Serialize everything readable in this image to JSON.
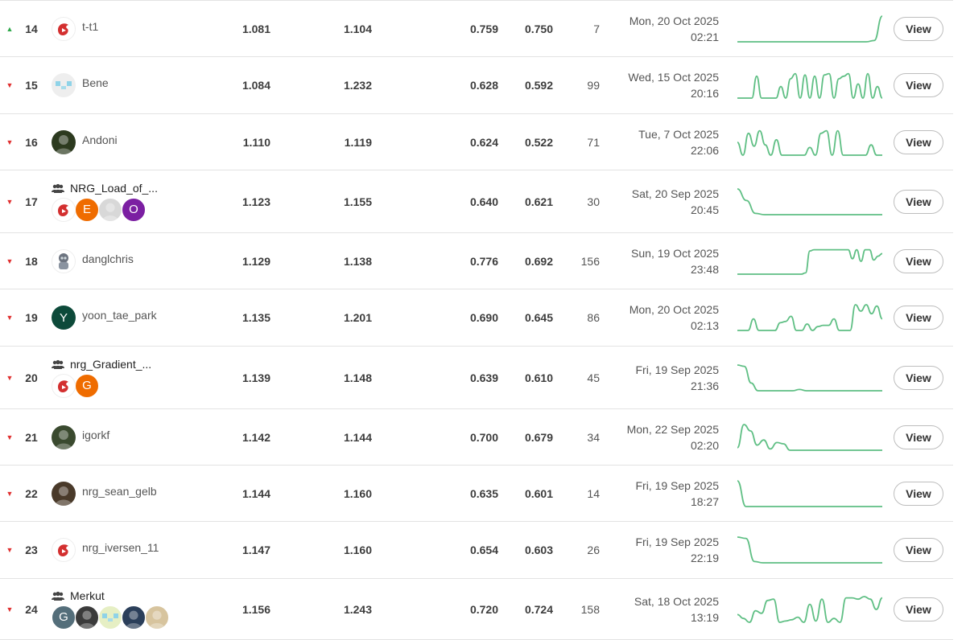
{
  "colors": {
    "up": "#2ea84a",
    "down": "#e03030",
    "spark": "#5fbf84"
  },
  "rows": [
    {
      "trend": "up",
      "rank": "14",
      "name": "t-t1",
      "team": false,
      "avatar": {
        "icon": "red-shield-logo",
        "bg": "#ffffff"
      },
      "score1": "1.081",
      "score2": "1.104",
      "score3": "0.759",
      "score4": "0.750",
      "entries": "7",
      "date": "Mon, 20 Oct 2025",
      "time": "02:21",
      "spark": [
        0,
        0,
        0,
        0,
        0,
        0,
        0,
        0,
        0,
        0,
        0,
        0,
        0,
        0,
        0,
        0,
        0,
        0.05,
        1
      ]
    },
    {
      "trend": "down",
      "rank": "15",
      "name": "Bene",
      "team": false,
      "avatar": {
        "icon": "pixel-logo",
        "bg": "#eeeeee"
      },
      "score1": "1.084",
      "score2": "1.232",
      "score3": "0.628",
      "score4": "0.592",
      "entries": "99",
      "date": "Wed, 15 Oct 2025",
      "time": "20:16",
      "spark": [
        0,
        0,
        0,
        0,
        0.85,
        0,
        0,
        0,
        0,
        0.45,
        0,
        0.75,
        0.95,
        0,
        0.9,
        0,
        0.85,
        0,
        0.9,
        0.95,
        0,
        0.75,
        0.85,
        0.95,
        0,
        0.55,
        0,
        0.95,
        0,
        0.45,
        0
      ]
    },
    {
      "trend": "down",
      "rank": "16",
      "name": "Andoni",
      "team": false,
      "avatar": {
        "icon": "photo-avatar",
        "bg": "#2c3a1f"
      },
      "score1": "1.110",
      "score2": "1.119",
      "score3": "0.624",
      "score4": "0.522",
      "entries": "71",
      "date": "Tue, 7 Oct 2025",
      "time": "22:06",
      "spark": [
        0.5,
        0,
        0.85,
        0.35,
        0.95,
        0.4,
        0,
        0.6,
        0,
        0,
        0,
        0,
        0,
        0.3,
        0,
        0.85,
        0.95,
        0,
        0.95,
        0,
        0,
        0,
        0,
        0,
        0.4,
        0,
        0
      ]
    },
    {
      "trend": "down",
      "rank": "17",
      "name": "NRG_Load_of_...",
      "team": true,
      "members": [
        {
          "icon": "red-dragon-logo",
          "bg": "#ffffff",
          "initial": ""
        },
        {
          "icon": "initial-e",
          "bg": "#ef6c00",
          "initial": "E"
        },
        {
          "icon": "photo-avatar",
          "bg": "#d8d8d8",
          "initial": ""
        },
        {
          "icon": "initial-o",
          "bg": "#7b1fa2",
          "initial": "O"
        }
      ],
      "score1": "1.123",
      "score2": "1.155",
      "score3": "0.640",
      "score4": "0.621",
      "entries": "30",
      "date": "Sat, 20 Sep 2025",
      "time": "20:45",
      "spark": [
        1,
        0.55,
        0.05,
        0,
        0,
        0,
        0,
        0,
        0,
        0,
        0,
        0,
        0,
        0,
        0,
        0,
        0
      ]
    },
    {
      "trend": "down",
      "rank": "18",
      "name": "danglchris",
      "team": false,
      "avatar": {
        "icon": "robot-avatar",
        "bg": "#ffffff"
      },
      "score1": "1.129",
      "score2": "1.138",
      "score3": "0.776",
      "score4": "0.692",
      "entries": "156",
      "date": "Sun, 19 Oct 2025",
      "time": "23:48",
      "spark": [
        0,
        0,
        0,
        0,
        0,
        0,
        0,
        0,
        0,
        0,
        0,
        0,
        0,
        0,
        0,
        0,
        0.05,
        0.9,
        0.95,
        0.95,
        0.95,
        0.95,
        0.95,
        0.95,
        0.95,
        0.95,
        0.95,
        0.6,
        0.95,
        0.5,
        0.95,
        0.95,
        0.55,
        0.7,
        0.8
      ]
    },
    {
      "trend": "down",
      "rank": "19",
      "name": "yoon_tae_park",
      "team": false,
      "avatar": {
        "icon": "initial-y",
        "bg": "#0d4a3a",
        "initial": "Y"
      },
      "score1": "1.135",
      "score2": "1.201",
      "score3": "0.690",
      "score4": "0.645",
      "entries": "86",
      "date": "Mon, 20 Oct 2025",
      "time": "02:13",
      "spark": [
        0,
        0,
        0,
        0.45,
        0,
        0,
        0,
        0,
        0.3,
        0.35,
        0.55,
        0,
        0,
        0.25,
        0,
        0.15,
        0.2,
        0.2,
        0.45,
        0,
        0,
        0,
        1,
        0.75,
        1,
        0.65,
        0.95,
        0.45
      ]
    },
    {
      "trend": "down",
      "rank": "20",
      "name": "nrg_Gradient_...",
      "team": true,
      "members": [
        {
          "icon": "red-dragon-logo",
          "bg": "#ffffff",
          "initial": ""
        },
        {
          "icon": "initial-g",
          "bg": "#ef6c00",
          "initial": "G"
        }
      ],
      "score1": "1.139",
      "score2": "1.148",
      "score3": "0.639",
      "score4": "0.610",
      "entries": "45",
      "date": "Fri, 19 Sep 2025",
      "time": "21:36",
      "spark": [
        1,
        0.95,
        0.3,
        0,
        0,
        0,
        0,
        0,
        0,
        0.05,
        0,
        0,
        0,
        0,
        0,
        0,
        0,
        0,
        0,
        0,
        0,
        0
      ]
    },
    {
      "trend": "down",
      "rank": "21",
      "name": "igorkf",
      "team": false,
      "avatar": {
        "icon": "photo-avatar",
        "bg": "#3a4a2f"
      },
      "score1": "1.142",
      "score2": "1.144",
      "score3": "0.700",
      "score4": "0.679",
      "entries": "34",
      "date": "Mon, 22 Sep 2025",
      "time": "02:20",
      "spark": [
        0.1,
        1,
        0.75,
        0.2,
        0.4,
        0.05,
        0.3,
        0.25,
        0,
        0,
        0,
        0,
        0,
        0,
        0,
        0,
        0,
        0,
        0,
        0,
        0,
        0,
        0
      ]
    },
    {
      "trend": "down",
      "rank": "22",
      "name": "nrg_sean_gelb",
      "team": false,
      "avatar": {
        "icon": "photo-avatar",
        "bg": "#4a3a2a"
      },
      "score1": "1.144",
      "score2": "1.160",
      "score3": "0.635",
      "score4": "0.601",
      "entries": "14",
      "date": "Fri, 19 Sep 2025",
      "time": "18:27",
      "spark": [
        1,
        0,
        0,
        0,
        0,
        0,
        0,
        0,
        0,
        0,
        0,
        0,
        0,
        0,
        0,
        0,
        0,
        0
      ]
    },
    {
      "trend": "down",
      "rank": "23",
      "name": "nrg_iversen_11",
      "team": false,
      "avatar": {
        "icon": "red-dragon-logo",
        "bg": "#ffffff"
      },
      "score1": "1.147",
      "score2": "1.160",
      "score3": "0.654",
      "score4": "0.603",
      "entries": "26",
      "date": "Fri, 19 Sep 2025",
      "time": "22:19",
      "spark": [
        1,
        0.95,
        0.05,
        0,
        0,
        0,
        0,
        0,
        0,
        0,
        0,
        0,
        0,
        0,
        0,
        0,
        0,
        0
      ]
    },
    {
      "trend": "down",
      "rank": "24",
      "name": "Merkut",
      "team": true,
      "members": [
        {
          "icon": "initial-g",
          "bg": "#546e7a",
          "initial": "G"
        },
        {
          "icon": "photo-avatar",
          "bg": "#3b3b3b",
          "initial": ""
        },
        {
          "icon": "pixel-logo",
          "bg": "#e6efc4",
          "initial": ""
        },
        {
          "icon": "photo-avatar",
          "bg": "#2b3f5a",
          "initial": ""
        },
        {
          "icon": "photo-avatar",
          "bg": "#d7c49e",
          "initial": ""
        }
      ],
      "score1": "1.156",
      "score2": "1.243",
      "score3": "0.720",
      "score4": "0.724",
      "entries": "158",
      "date": "Sat, 18 Oct 2025",
      "time": "13:19",
      "spark": [
        0.3,
        0.15,
        0,
        0.45,
        0.35,
        0.85,
        0.9,
        0,
        0.05,
        0.1,
        0.2,
        0,
        0.7,
        0.05,
        0.9,
        0,
        0.15,
        0,
        0.95,
        0.95,
        0.9,
        1,
        0.9,
        0.5,
        0.95
      ]
    }
  ],
  "view_label": "View"
}
